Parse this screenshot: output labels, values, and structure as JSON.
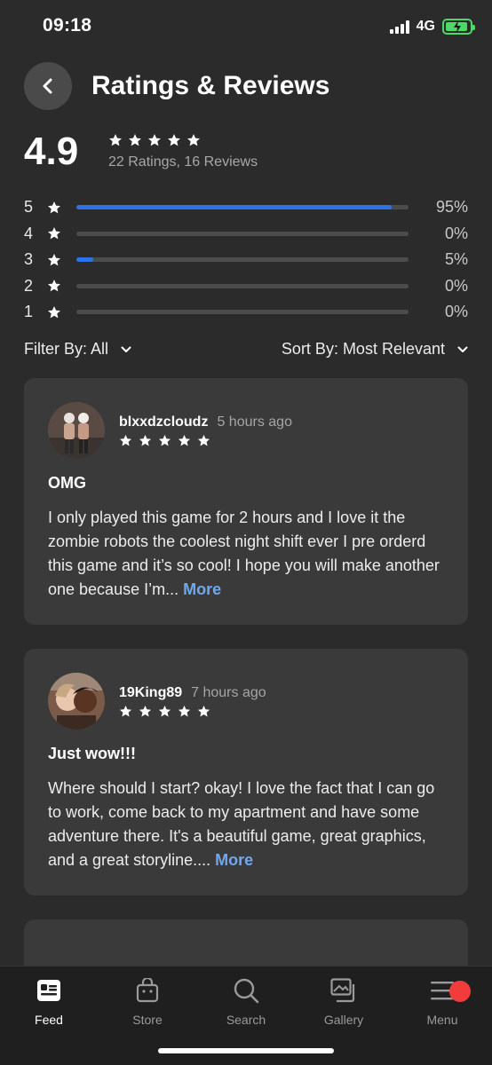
{
  "status_bar": {
    "time": "09:18",
    "network": "4G"
  },
  "header": {
    "title": "Ratings & Reviews"
  },
  "summary": {
    "rating": "4.9",
    "count_text": "22 Ratings, 16 Reviews"
  },
  "rating_bars": [
    {
      "stars": "5",
      "percent": 95,
      "label": "95%"
    },
    {
      "stars": "4",
      "percent": 0,
      "label": "0%"
    },
    {
      "stars": "3",
      "percent": 5,
      "label": "5%"
    },
    {
      "stars": "2",
      "percent": 0,
      "label": "0%"
    },
    {
      "stars": "1",
      "percent": 0,
      "label": "0%"
    }
  ],
  "filters": {
    "filter_label": "Filter By: All",
    "sort_label": "Sort By: Most Relevant"
  },
  "reviews": [
    {
      "username": "blxxdzcloudz",
      "time_ago": "5 hours ago",
      "stars": 5,
      "title": "OMG",
      "body": "I only played this game for 2 hours and I love it the zombie robots the coolest night shift ever I pre orderd this game and it’s so cool! I hope you will make another one because I’m...",
      "more": "More"
    },
    {
      "username": "19King89",
      "time_ago": "7 hours ago",
      "stars": 5,
      "title": "Just wow!!!",
      "body": "Where should I start? okay! I love the fact that I can go to work, come back to my apartment and have some adventure there. It's a beautiful game, great graphics, and a great storyline....",
      "more": "More"
    }
  ],
  "tab_bar": {
    "tabs": [
      {
        "label": "Feed",
        "icon": "feed-icon"
      },
      {
        "label": "Store",
        "icon": "store-icon"
      },
      {
        "label": "Search",
        "icon": "search-icon"
      },
      {
        "label": "Gallery",
        "icon": "gallery-icon"
      },
      {
        "label": "Menu",
        "icon": "menu-icon"
      }
    ],
    "active": "Feed"
  },
  "colors": {
    "background": "#2b2b2b",
    "card": "#3a3a3a",
    "accent_bar": "#2d72e8",
    "link": "#6fa8ec",
    "notification": "#f23c3c",
    "battery": "#4cd964"
  }
}
